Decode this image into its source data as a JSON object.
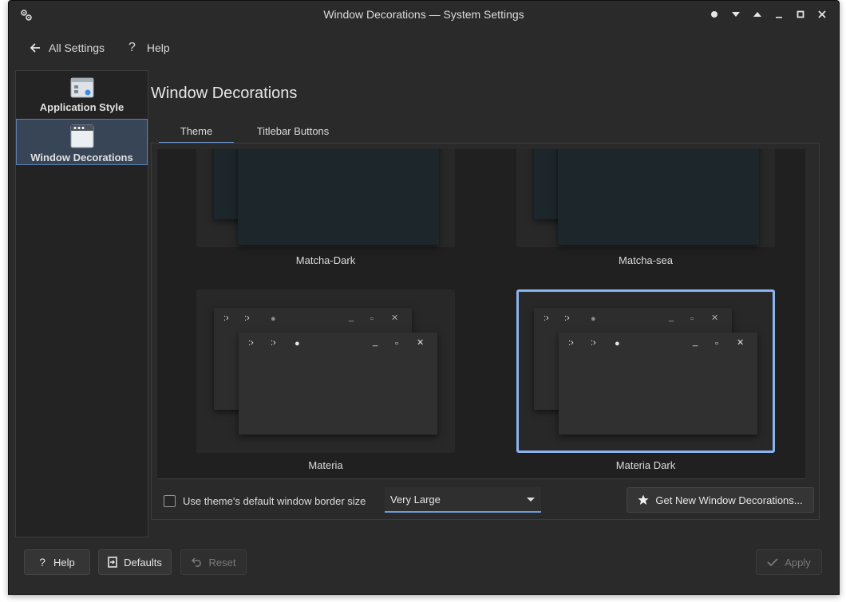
{
  "window": {
    "title": "Window Decorations — System Settings"
  },
  "toolbar": {
    "back_label": "All Settings",
    "help_label": "Help"
  },
  "sidebar": {
    "items": [
      {
        "label": "Application Style",
        "icon": "application-style-icon",
        "selected": false
      },
      {
        "label": "Window Decorations",
        "icon": "window-decorations-icon",
        "selected": true
      }
    ]
  },
  "page": {
    "title": "Window Decorations"
  },
  "tabs": [
    {
      "label": "Theme",
      "active": true
    },
    {
      "label": "Titlebar Buttons",
      "active": false
    }
  ],
  "themes": [
    {
      "name": "Matcha-Dark",
      "selected": false
    },
    {
      "name": "Matcha-sea",
      "selected": false
    },
    {
      "name": "Materia",
      "selected": false
    },
    {
      "name": "Materia Dark",
      "selected": true
    }
  ],
  "options": {
    "use_default_border_label": "Use theme's default window border size",
    "use_default_border_checked": false,
    "border_size_value": "Very Large",
    "get_new_label": "Get New Window Decorations..."
  },
  "footer": {
    "help_label": "Help",
    "defaults_label": "Defaults",
    "reset_label": "Reset",
    "apply_label": "Apply"
  },
  "colors": {
    "accent": "#8ab4f0",
    "window_bg": "#2a2a2a"
  }
}
